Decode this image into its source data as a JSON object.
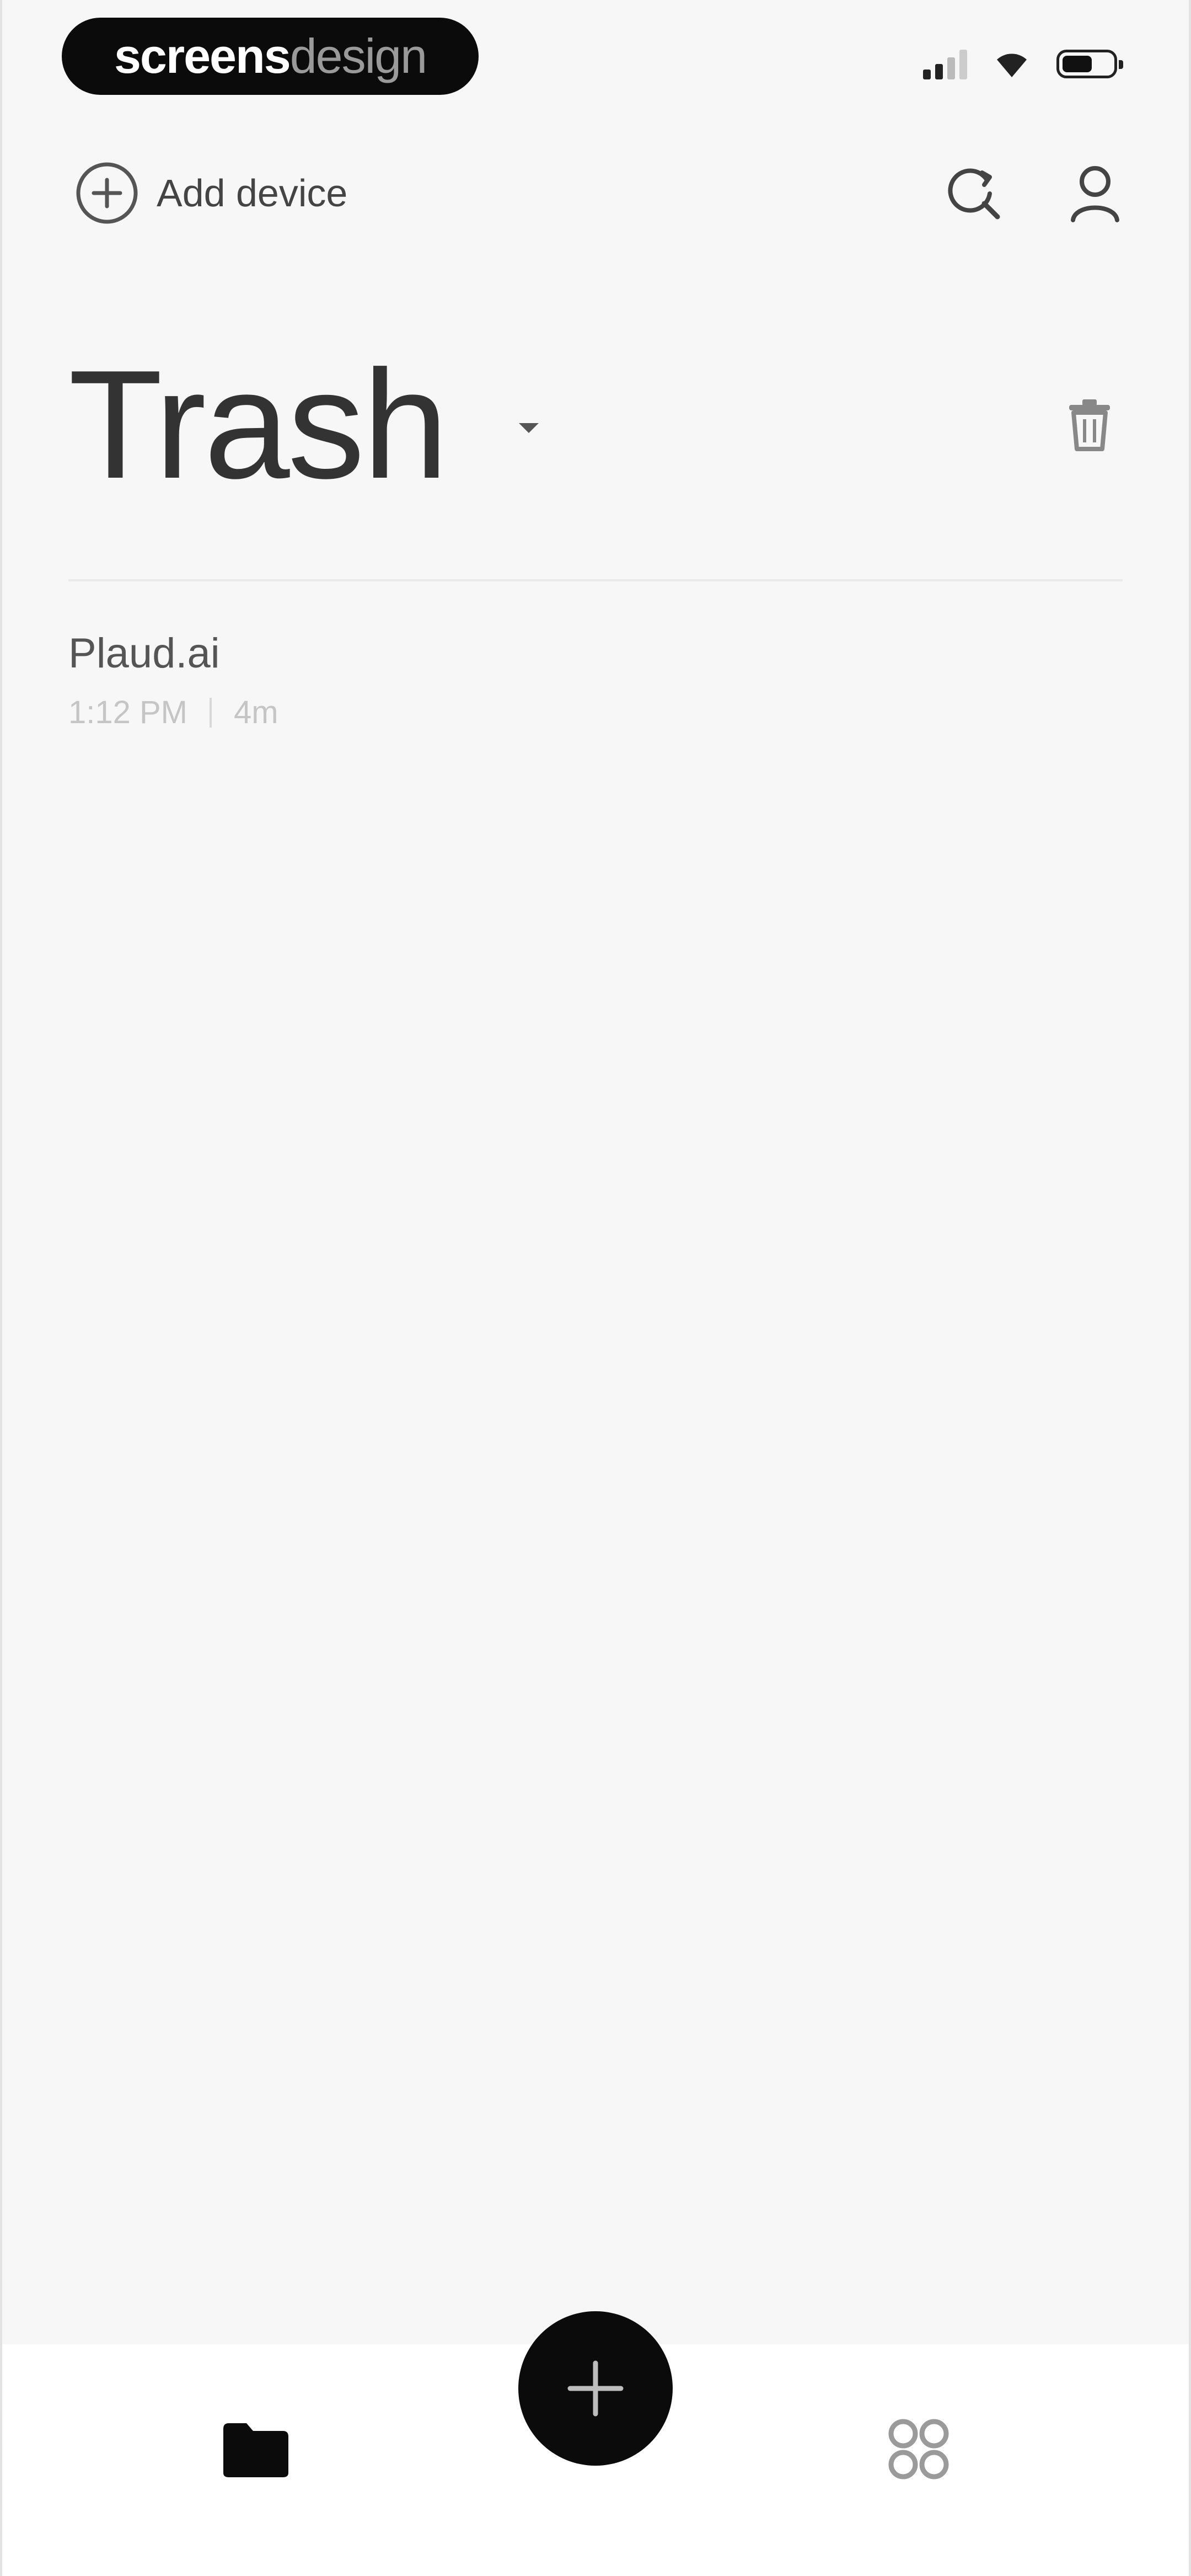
{
  "status_bar": {
    "brand_part1": "screens",
    "brand_part2": "design"
  },
  "header": {
    "add_device_label": "Add device",
    "icons": {
      "add": "plus-circle-icon",
      "search": "search-refresh-icon",
      "profile": "user-icon"
    }
  },
  "page": {
    "title": "Trash",
    "icons": {
      "dropdown": "chevron-down-icon",
      "trash": "trash-can-icon"
    }
  },
  "recordings": [
    {
      "title": "Plaud.ai",
      "time": "1:12 PM",
      "duration": "4m"
    }
  ],
  "bottom_nav": {
    "items": [
      {
        "icon": "folder-icon",
        "active": true
      },
      {
        "icon": "plus-icon",
        "role": "record"
      },
      {
        "icon": "apps-grid-icon",
        "active": false
      }
    ]
  },
  "colors": {
    "background": "#f7f7f7",
    "accent": "#0b0b0b",
    "text_primary": "#333333",
    "text_muted": "#c5c5c5"
  }
}
